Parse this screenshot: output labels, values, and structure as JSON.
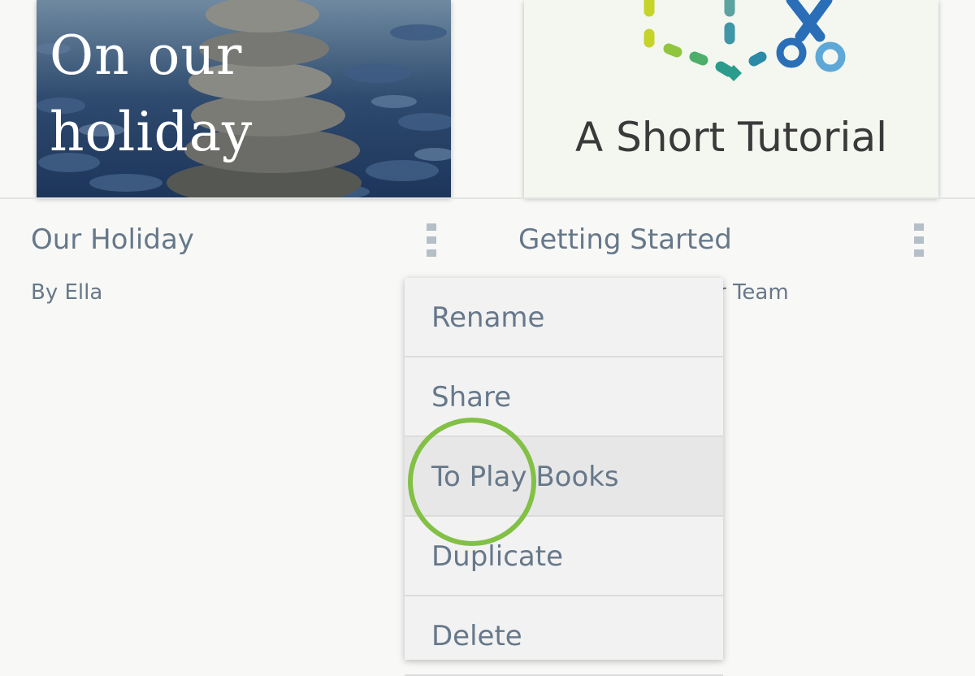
{
  "books": [
    {
      "cover_title": "On our\nholiday",
      "title": "Our Holiday",
      "author": "By Ella"
    },
    {
      "cover_title": "A Short Tutorial",
      "title": "Getting Started",
      "author_partial": "r Team"
    }
  ],
  "context_menu": {
    "items": [
      "Rename",
      "Share",
      "To Play Books",
      "Duplicate",
      "Delete"
    ],
    "highlighted_item": "To Play Books"
  },
  "colors": {
    "background": "#f8f8f6",
    "text": "#66788a",
    "menu_bg": "#f2f2f2",
    "highlight_ring": "#82c046"
  },
  "icons": {
    "overflow": "kebab-menu-icon",
    "tutorial_logo": "scissors-book-logo-icon"
  }
}
